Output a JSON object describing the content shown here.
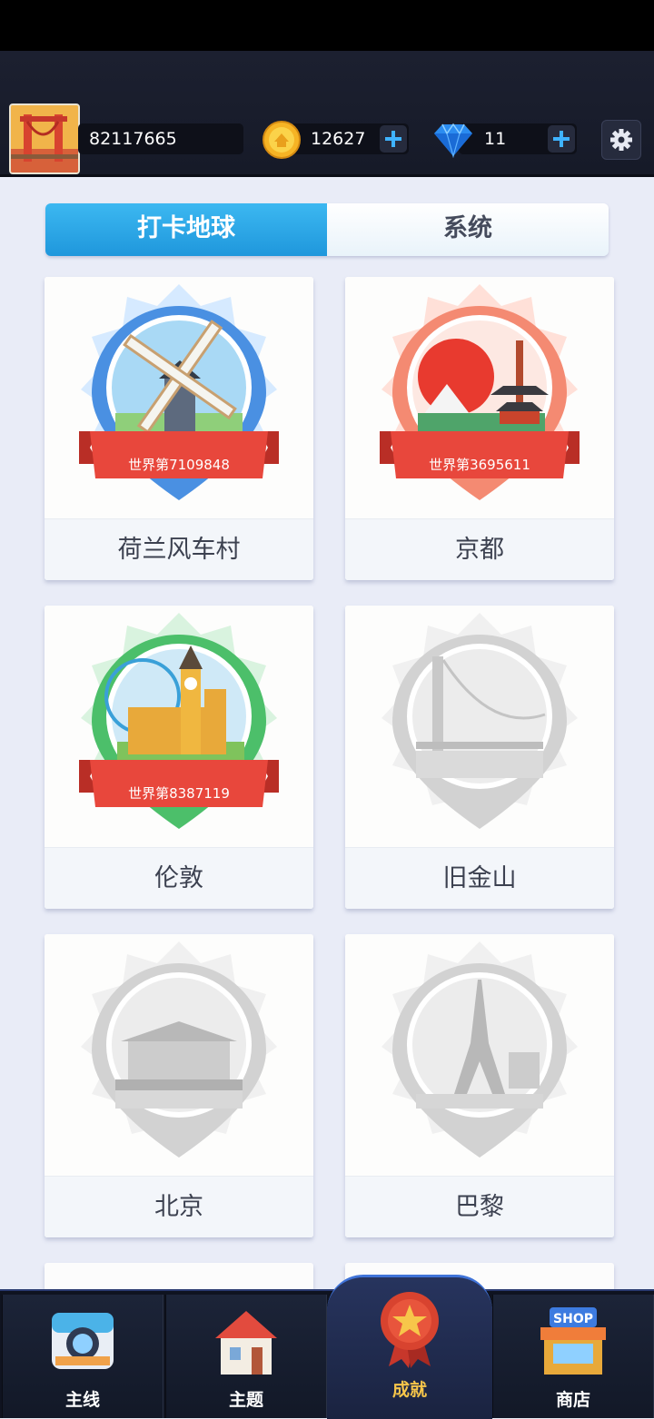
{
  "header": {
    "player_id": "82117665",
    "coins": "12627",
    "gems": "11"
  },
  "tabs": [
    {
      "label": "打卡地球",
      "active": true
    },
    {
      "label": "系统",
      "active": false
    }
  ],
  "cards": [
    {
      "name": "荷兰风车村",
      "rank": "世界第7109848",
      "unlocked": true,
      "color": "#4a90e2"
    },
    {
      "name": "京都",
      "rank": "世界第3695611",
      "unlocked": true,
      "color": "#f07a62"
    },
    {
      "name": "伦敦",
      "rank": "世界第8387119",
      "unlocked": true,
      "color": "#4cbf6a"
    },
    {
      "name": "旧金山",
      "rank": "",
      "unlocked": false,
      "color": "#cfcfcf"
    },
    {
      "name": "北京",
      "rank": "",
      "unlocked": false,
      "color": "#cfcfcf"
    },
    {
      "name": "巴黎",
      "rank": "",
      "unlocked": false,
      "color": "#cfcfcf"
    }
  ],
  "nav": [
    {
      "label": "主线",
      "icon": "camera-icon"
    },
    {
      "label": "主题",
      "icon": "house-icon"
    },
    {
      "label": "成就",
      "icon": "star-medal-icon",
      "active": true
    },
    {
      "label": "商店",
      "icon": "shop-icon"
    }
  ],
  "colors": {
    "tab_active": "#2aa8ea",
    "ribbon": "#e8473c",
    "nav_active_label": "#f7c64a"
  }
}
